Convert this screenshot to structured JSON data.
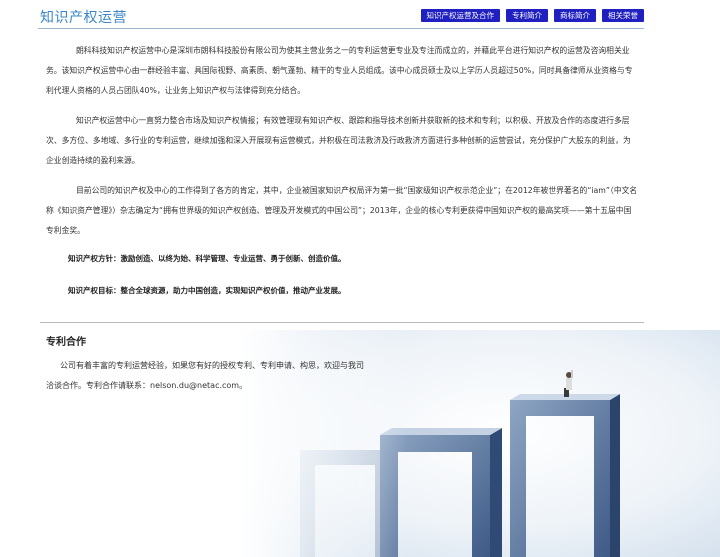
{
  "header": {
    "title": "知识产权运营",
    "nav": [
      {
        "label": "知识产权运营及合作"
      },
      {
        "label": "专利简介"
      },
      {
        "label": "商标简介"
      },
      {
        "label": "相关荣誉"
      }
    ]
  },
  "main": {
    "paragraphs": [
      "朗科科技知识产权运营中心是深圳市朗科科技股份有限公司为使其主营业务之一的专利运营更专业及专注而成立的，并藉此平台进行知识产权的运营及咨询相关业务。该知识产权运营中心由一群经验丰富、具国际视野、高素质、朝气蓬勃、精干的专业人员组成。该中心成员硕士及以上学历人员超过50%，同时具备律师从业资格与专利代理人资格的人员占团队40%，让业务上知识产权与法律得到充分结合。",
      "知识产权运营中心一直努力整合市场及知识产权情报；有效管理现有知识产权、跟踪和指导技术创新并获取新的技术和专利；以积极、开放及合作的态度进行多层次、多方位、多地域、多行业的专利运营，继续加强和深入开展现有运营模式，并积极在司法救济及行政救济方面进行多种创新的运营尝试，充分保护广大股东的利益，为企业创造持续的盈利来源。",
      "目前公司的知识产权及中心的工作得到了各方的肯定，其中，企业被国家知识产权局评为第一批“国家级知识产权示范企业”；在2012年被世界著名的“iam”（中文名称《知识资产管理》）杂志确定为“拥有世界级的知识产权创造、管理及开发模式的中国公司”；2013年，企业的核心专利更获得中国知识产权的最高奖项——第十五届中国专利金奖。"
    ],
    "motto_policy": "知识产权方针：激励创造、以终为始、科学管理、专业运营、勇于创新、创造价值。",
    "motto_goal": "知识产权目标：整合全球资源，助力中国创造，实现知识产权价值，推动产业发展。"
  },
  "cooperation": {
    "title": "专利合作",
    "text": "公司有着丰富的专利运营经验，如果您有好的授权专利、专利申请、构思，欢迎与我司洽谈合作。专利合作请联系：nelson.du@netac.com。"
  },
  "colors": {
    "title": "#3a86c8",
    "nav_bg": "#2020c0",
    "rule": "#9ab6d4"
  }
}
